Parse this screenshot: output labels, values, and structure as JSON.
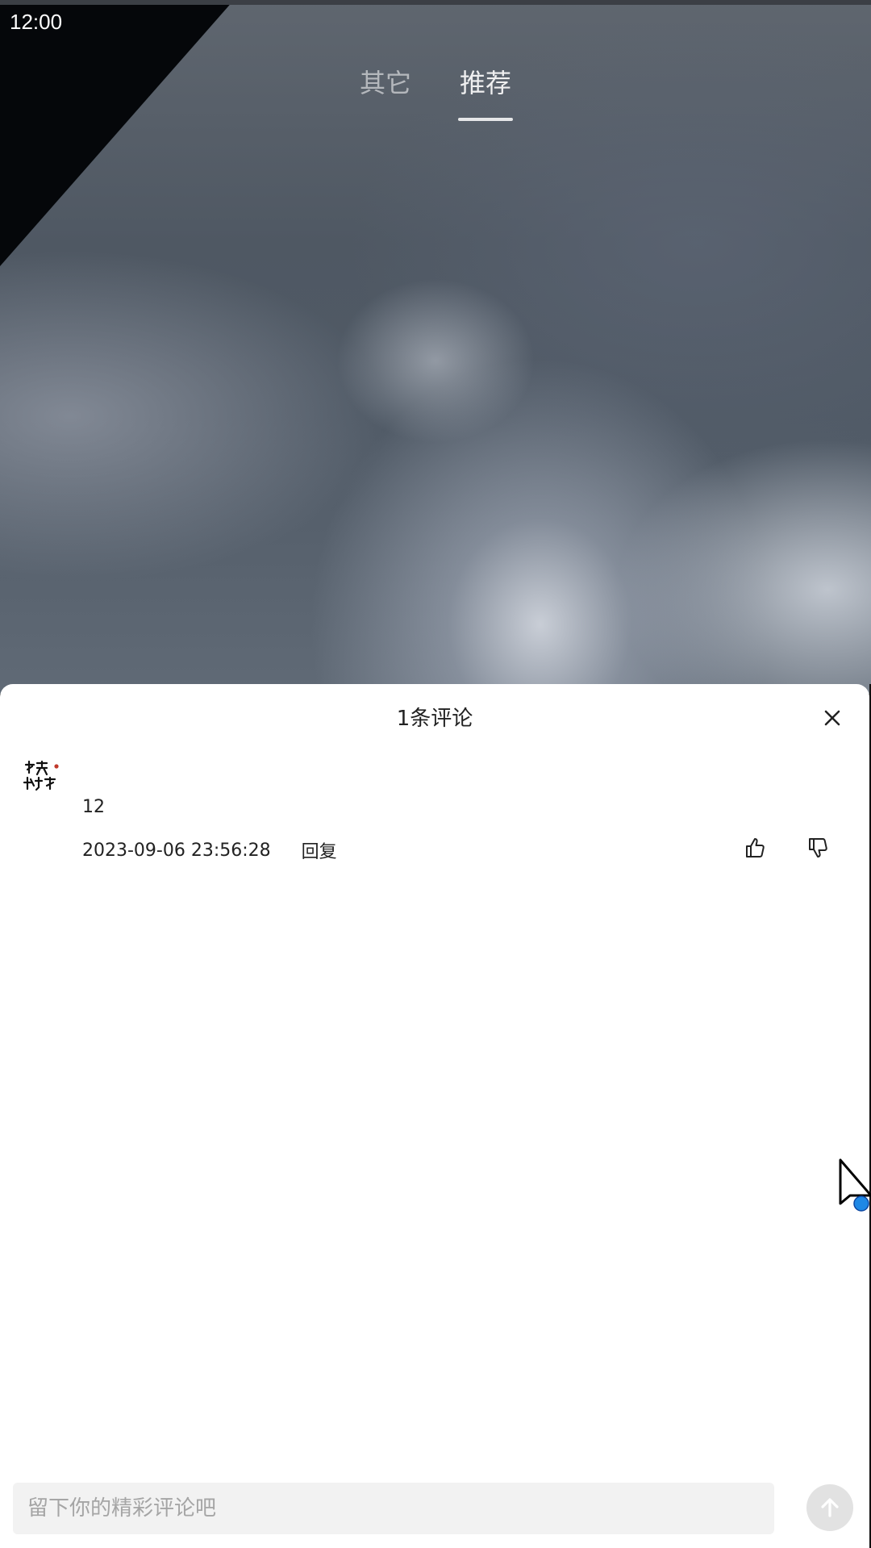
{
  "status_bar": {
    "time": "12:00"
  },
  "top_tabs": [
    {
      "label": "其它",
      "active": false
    },
    {
      "label": "推荐",
      "active": true
    }
  ],
  "comments_sheet": {
    "title": "1条评论",
    "comments": [
      {
        "text": "12",
        "timestamp": "2023-09-06 23:56:28",
        "reply_label": "回复"
      }
    ],
    "composer": {
      "placeholder": "留下你的精彩评论吧"
    }
  },
  "icons": {
    "close": "close-icon",
    "like": "thumbs-up-icon",
    "dislike": "thumbs-down-icon",
    "send": "arrow-up-icon"
  },
  "colors": {
    "sheet_background": "#ffffff",
    "input_background": "#f2f2f2",
    "send_button": "#e2e2e2",
    "text_primary": "#222222",
    "placeholder": "#a5a5a5"
  }
}
